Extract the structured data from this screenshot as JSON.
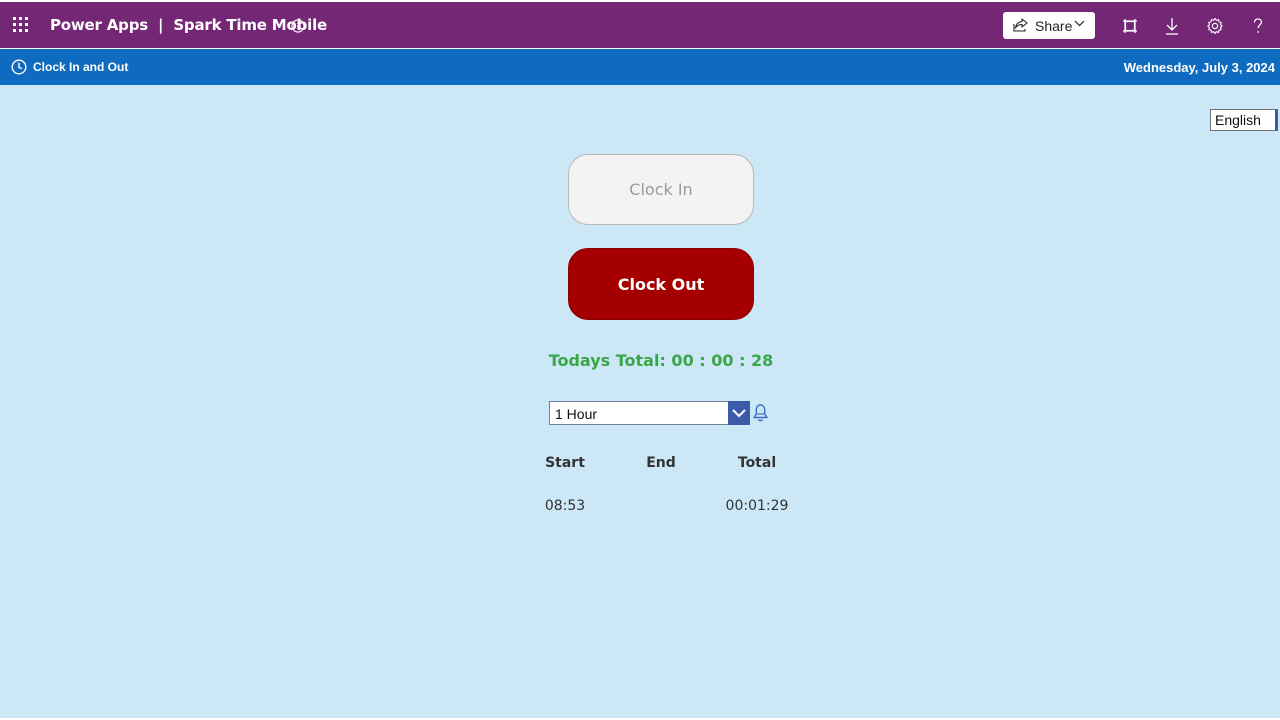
{
  "topbar": {
    "app_title": "Power Apps  |  Spark Time Mobile",
    "share_label": "Share",
    "icons": [
      "app-launcher-icon",
      "info-icon",
      "share-icon",
      "chevron-down-icon",
      "fit-to-screen-icon",
      "download-icon",
      "settings-icon",
      "help-icon"
    ],
    "color": "#742774"
  },
  "subbar": {
    "page_name": "Clock In and Out",
    "date": "Wednesday, July 3, 2024",
    "color": "#0e6bbf"
  },
  "main": {
    "language": "English",
    "clock_in_label": "Clock In",
    "clock_out_label": "Clock Out",
    "todays_total": "Todays Total: 00 : 00 : 28",
    "reminder_value": "1 Hour",
    "table": {
      "headers": [
        "Start",
        "End",
        "Total"
      ],
      "rows": [
        [
          "08:53",
          "",
          "00:01:29"
        ]
      ]
    },
    "colors": {
      "background": "#cce7f5",
      "clock_out": "#a50000",
      "total_text": "#3aa64a",
      "dropdown_accent": "#3b5ba9"
    }
  }
}
